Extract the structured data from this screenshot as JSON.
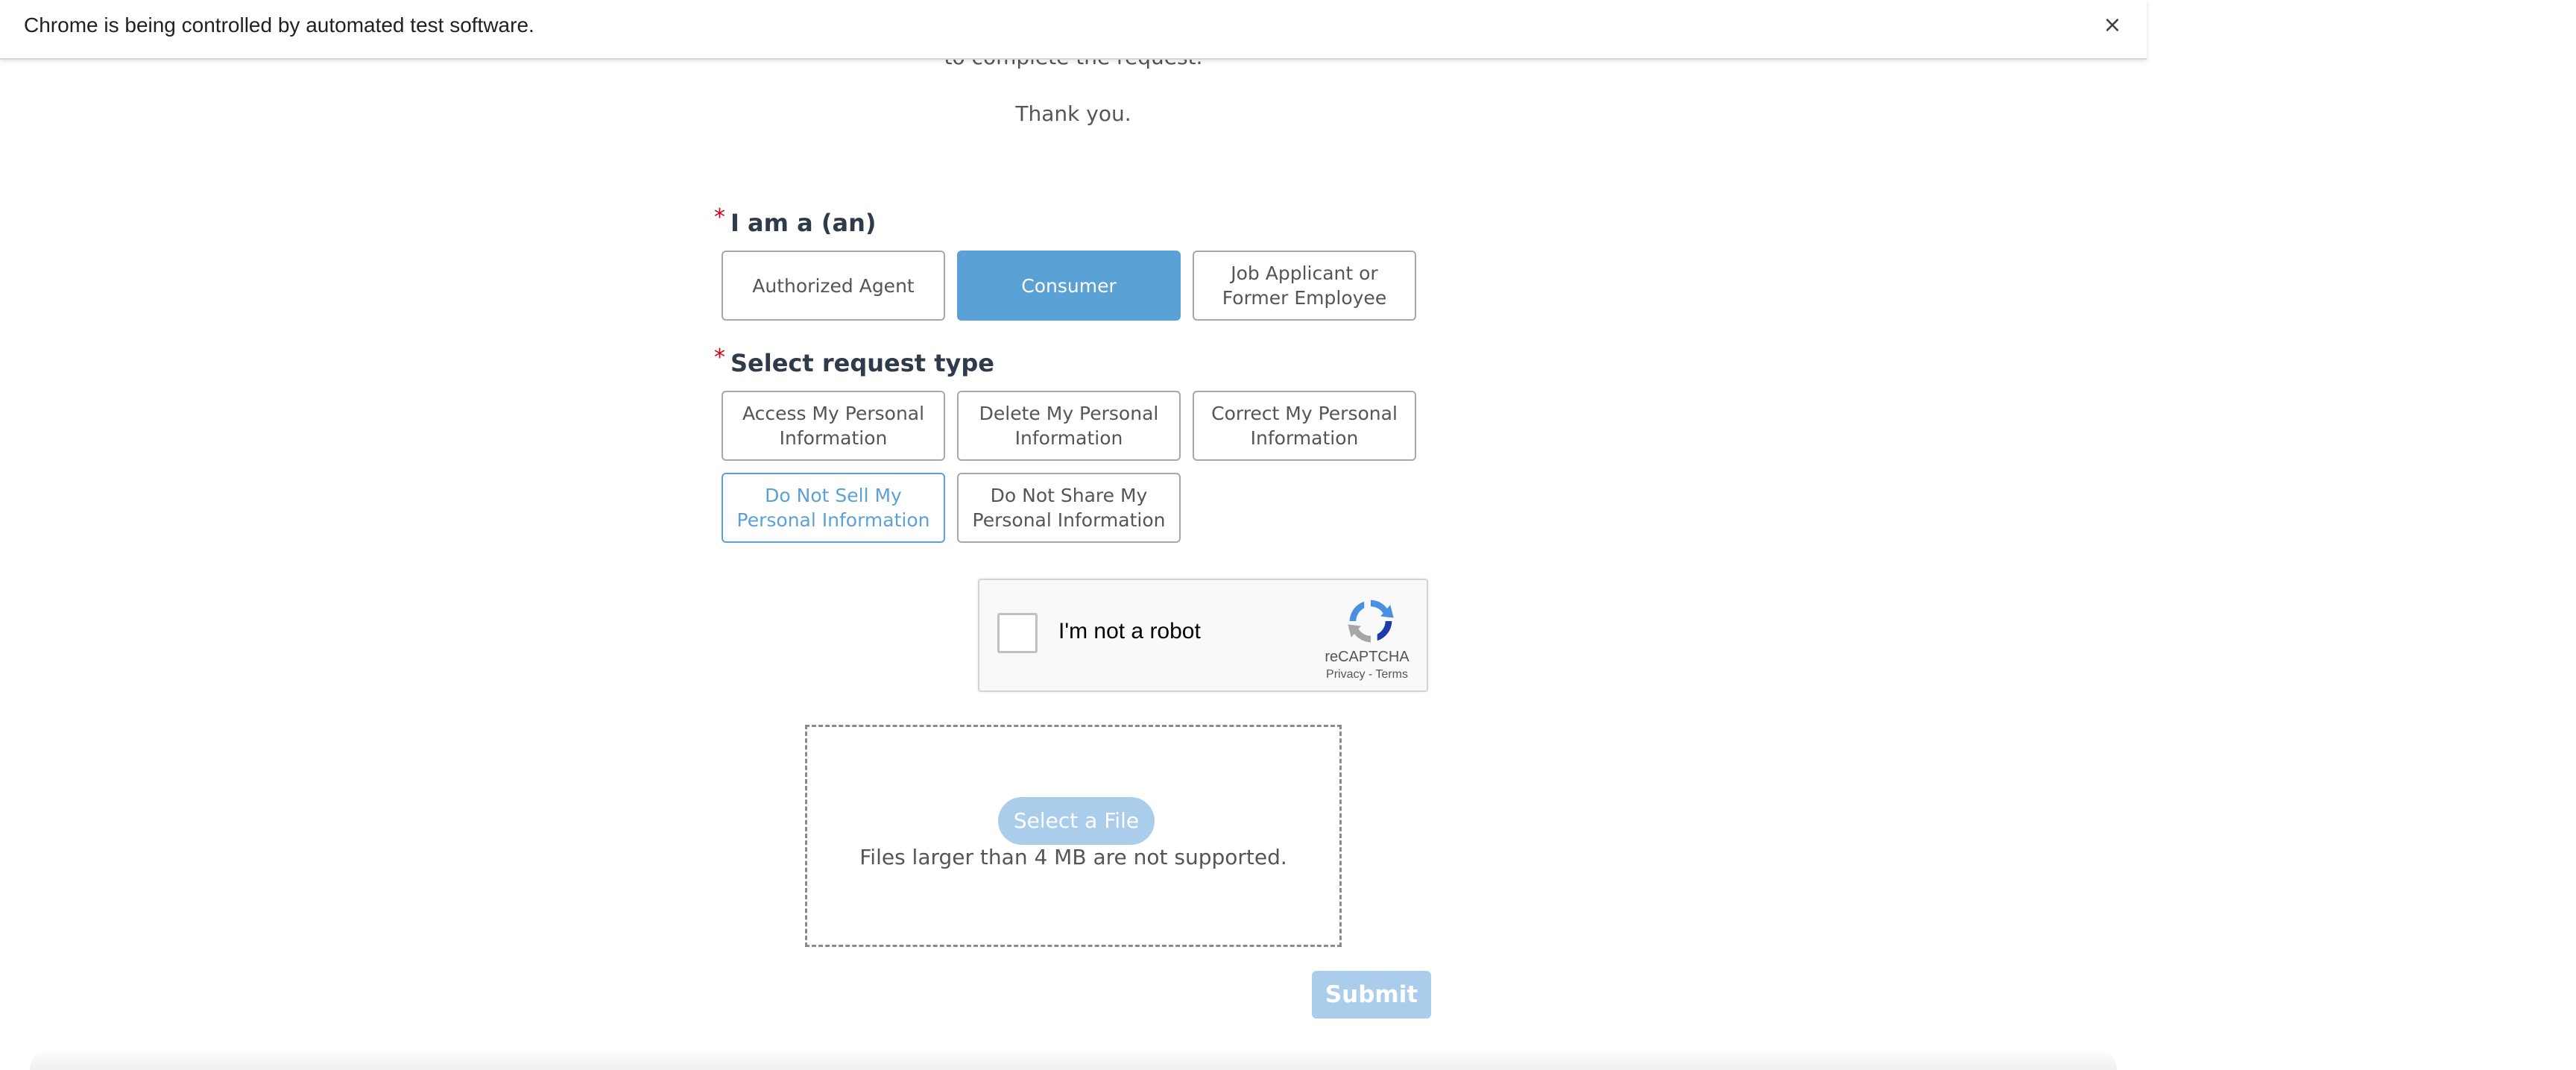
{
  "infobar": {
    "message": "Chrome is being controlled by automated test software.",
    "close_glyph": "×"
  },
  "intro": {
    "partial_line": "to complete the request.",
    "thanks": "Thank you."
  },
  "requester": {
    "required_mark": "*",
    "label": "I am a (an)",
    "options": [
      {
        "label": "Authorized Agent",
        "selected": false
      },
      {
        "label": "Consumer",
        "selected": true
      },
      {
        "label": "Job Applicant or Former Employee",
        "selected": false
      }
    ]
  },
  "request_type": {
    "required_mark": "*",
    "label": "Select request type",
    "options": [
      {
        "label": "Access My Personal Information",
        "selected": false
      },
      {
        "label": "Delete My Personal Information",
        "selected": false
      },
      {
        "label": "Correct My Personal Information",
        "selected": false
      },
      {
        "label": "Do Not Sell My Personal Information",
        "selected": true
      },
      {
        "label": "Do Not Share My Personal Information",
        "selected": false
      }
    ]
  },
  "recaptcha": {
    "label": "I'm not a robot",
    "brand": "reCAPTCHA",
    "privacy": "Privacy",
    "separator": "-",
    "terms": "Terms",
    "icon": "recaptcha-logo-icon"
  },
  "upload": {
    "button_label": "Select a File",
    "note": "Files larger than 4 MB are not supported."
  },
  "submit": {
    "label": "Submit"
  },
  "colors": {
    "accent": "#5aa2d6",
    "accent_disabled": "#a9cdeb",
    "required": "#d0021b"
  }
}
